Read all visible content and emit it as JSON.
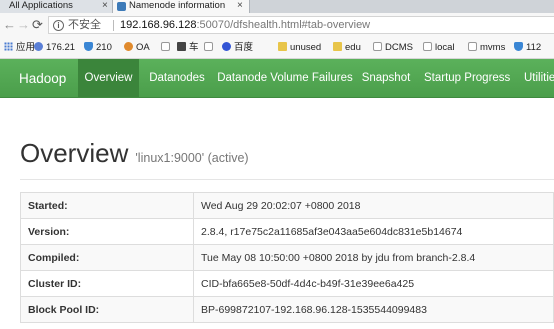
{
  "browser": {
    "tabs": [
      {
        "title": "All Applications"
      },
      {
        "title": "Namenode information"
      }
    ],
    "address": {
      "security_label": "不安全",
      "url_host": "192.168.96.128",
      "url_rest": ":50070/dfshealth.html#tab-overview"
    },
    "bookmarks": [
      {
        "label": "应用",
        "icon": "apps-icon"
      },
      {
        "label": "176.21",
        "icon": "globe-icon"
      },
      {
        "label": "210",
        "icon": "shield-icon"
      },
      {
        "label": "OA",
        "icon": "circle-icon"
      },
      {
        "label": "",
        "icon": "document-icon"
      },
      {
        "label": "车",
        "icon": "car-icon"
      },
      {
        "label": "",
        "icon": "page-icon"
      },
      {
        "label": "百度",
        "icon": "baidu-paw-icon"
      },
      {
        "label": "unused",
        "icon": "folder-icon"
      },
      {
        "label": "edu",
        "icon": "folder-icon"
      },
      {
        "label": "DCMS",
        "icon": "page-icon"
      },
      {
        "label": "local",
        "icon": "page-icon"
      },
      {
        "label": "mvms",
        "icon": "page-icon"
      },
      {
        "label": "112",
        "icon": "shield-icon"
      }
    ]
  },
  "navbar": {
    "brand": "Hadoop",
    "items": [
      {
        "label": "Overview",
        "active": true
      },
      {
        "label": "Datanodes"
      },
      {
        "label": "Datanode Volume Failures"
      },
      {
        "label": "Snapshot"
      },
      {
        "label": "Startup Progress"
      },
      {
        "label": "Utilities"
      }
    ],
    "color": "#4fa74f",
    "active_color": "#3b853b"
  },
  "overview": {
    "title": "Overview",
    "subtitle": "'linux1:9000' (active)",
    "rows": [
      {
        "key": "Started:",
        "value": "Wed Aug 29 20:02:07 +0800 2018"
      },
      {
        "key": "Version:",
        "value": "2.8.4, r17e75c2a11685af3e043aa5e604dc831e5b14674"
      },
      {
        "key": "Compiled:",
        "value": "Tue May 08 10:50:00 +0800 2018 by jdu from branch-2.8.4"
      },
      {
        "key": "Cluster ID:",
        "value": "CID-bfa665e8-50df-4d4c-b49f-31e39ee6a425"
      },
      {
        "key": "Block Pool ID:",
        "value": "BP-699872107-192.168.96.128-1535544099483"
      }
    ]
  }
}
